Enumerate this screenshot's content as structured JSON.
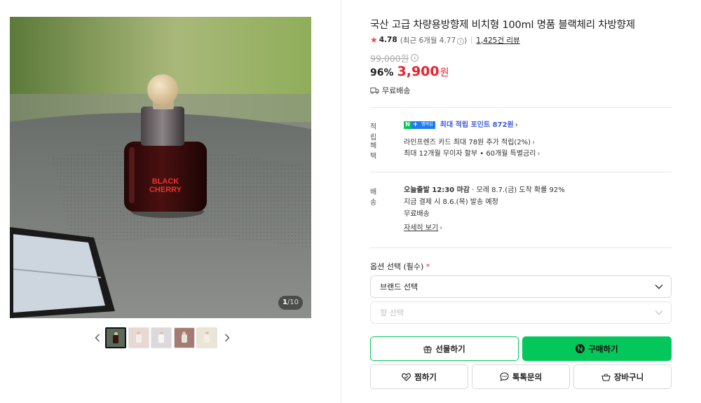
{
  "gallery": {
    "counter_current": "1",
    "counter_total": "/10",
    "bottle_label_line1": "BLACK",
    "bottle_label_line2": "CHERRY",
    "thumbnails": [
      {
        "bg": "#5a6a58",
        "bottle": "#3a1414"
      },
      {
        "bg": "#e8d8d2",
        "bottle": "#f4eeee"
      },
      {
        "bg": "#ddd8dc",
        "bottle": "#f6f6f6"
      },
      {
        "bg": "#a47a72",
        "bottle": "#e8e2dc"
      },
      {
        "bg": "#ece4d4",
        "bottle": "#f4eeea"
      }
    ]
  },
  "product": {
    "title": "국산 고급 차량용방향제 비치형 100ml 명품 블랙체리 차방향제",
    "rating": "4.78",
    "recent_rating": "(최근 6개월 4.77",
    "recent_rating_close": ")",
    "review_count": "1,425건 리뷰",
    "original_price": "99,000원",
    "discount": "96%",
    "price": "3,900",
    "price_unit": "원",
    "shipping_summary": "무료배송"
  },
  "points": {
    "label": "적립",
    "badge_n": "N",
    "badge_plus": "+",
    "badge_member": "멤버십",
    "text": "최대 적립 포인트 872원"
  },
  "benefits": {
    "label": "혜택",
    "line1": "라인프렌즈 카드 최대 78원 추가 적립(2%)",
    "line2": "최대 12개월 무이자 할부 • 60개월 특별금리"
  },
  "delivery": {
    "label": "배송",
    "today_ship": "오늘출발 12:30 마감",
    "arrival": " · 모레 8.7.(금) 도착 확률 92%",
    "ship_note": "지금 결제 시 8.6.(목) 발송 예정",
    "fee": "무료배송",
    "details_link": "자세히 보기"
  },
  "options": {
    "label": "옵션 선택 (필수)",
    "required_mark": "*",
    "select1": "브랜드 선택",
    "select2": "향 선택"
  },
  "buttons": {
    "gift": "선물하기",
    "buy": "구매하기",
    "wish": "찜하기",
    "talk": "톡톡문의",
    "cart": "장바구니"
  },
  "colors": {
    "accent_green": "#03c75a",
    "price_red": "#e8212e",
    "points_blue": "#3b5bdb"
  }
}
